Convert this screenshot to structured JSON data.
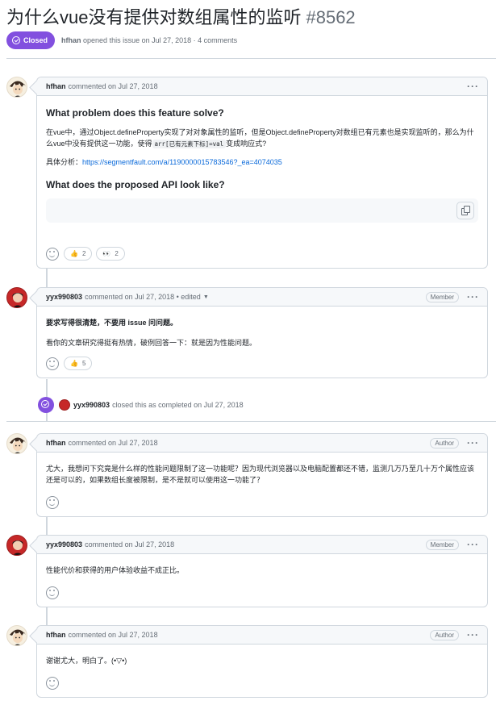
{
  "issue": {
    "title": "为什么vue没有提供对数组属性的监听",
    "number": "#8562",
    "state": "Closed",
    "author": "hfhan",
    "opened_text": "opened this issue on Jul 27, 2018 · 4 comments"
  },
  "comments": [
    {
      "author": "hfhan",
      "meta": "commented on Jul 27, 2018",
      "heading1": "What problem does this feature solve?",
      "para1_a": "在vue中，通过Object.defineProperty实现了对对象属性的监听，但是Object.defineProperty对数组已有元素也是实现监听的，那么为什么vue中没有提供这一功能，使得",
      "para1_code": "arr[已有元素下标]=val",
      "para1_b": "变成响应式?",
      "link_prefix": "具体分析：",
      "link_text": "https://segmentfault.com/a/1190000015783546?_ea=4074035",
      "heading2": "What does the proposed API look like?",
      "reactions": [
        {
          "emoji": "👍",
          "count": "2"
        },
        {
          "emoji": "👀",
          "count": "2"
        }
      ]
    },
    {
      "author": "yyx990803",
      "meta": "commented on Jul 27, 2018 • edited",
      "role": "Member",
      "para1": "要求写得很清楚，不要用 issue 问问题。",
      "para2": "看你的文章研究得挺有热情，破例回答一下：就是因为性能问题。",
      "reactions": [
        {
          "emoji": "👍",
          "count": "5"
        }
      ]
    },
    {
      "author": "hfhan",
      "meta": "commented on Jul 27, 2018",
      "role": "Author",
      "para1": "尤大，我想问下究竟是什么样的性能问题限制了这一功能呢？因为现代浏览器以及电脑配置都还不错，监测几万乃至几十万个属性应该还是可以的，如果数组长度被限制，是不是就可以使用这一功能了？"
    },
    {
      "author": "yyx990803",
      "meta": "commented on Jul 27, 2018",
      "role": "Member",
      "para1": "性能代价和获得的用户体验收益不成正比。"
    },
    {
      "author": "hfhan",
      "meta": "commented on Jul 27, 2018",
      "role": "Author",
      "para1": "谢谢尤大，明白了。(•▽•)"
    }
  ],
  "event": {
    "actor": "yyx990803",
    "text": "closed this as completed on Jul 27, 2018"
  },
  "icons": {
    "state": "check-circle-icon",
    "more": "kebab-horizontal-icon",
    "copy": "copy-icon",
    "react": "smiley-icon"
  },
  "colors": {
    "closed_purple": "#8250df",
    "link_blue": "#0969da",
    "border": "#d0d7de"
  }
}
